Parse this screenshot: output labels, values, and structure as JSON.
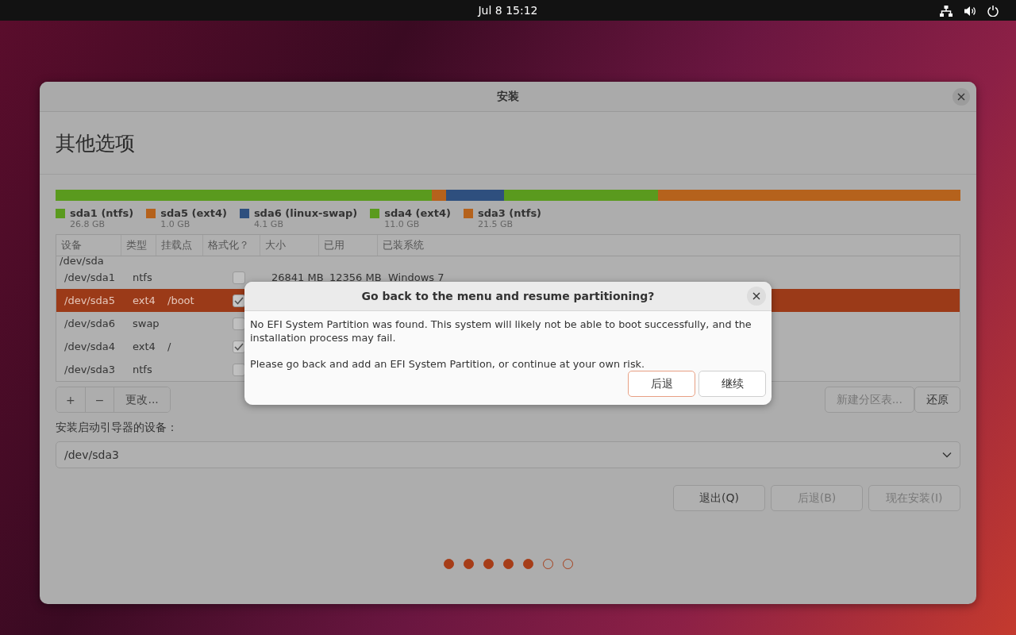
{
  "top_bar": {
    "clock": "Jul 8  15:12"
  },
  "window": {
    "title": "安装",
    "heading": "其他选项"
  },
  "partitions": [
    {
      "name": "sda1 (ntfs)",
      "size": "26.8 GB",
      "color": "#5a9a1e"
    },
    {
      "name": "sda5 (ext4)",
      "size": "1.0 GB",
      "color": "#b5621c"
    },
    {
      "name": "sda6 (linux-swap)",
      "size": "4.1 GB",
      "color": "#2e4f7e"
    },
    {
      "name": "sda4 (ext4)",
      "size": "11.0 GB",
      "color": "#5a9a1e"
    },
    {
      "name": "sda3 (ntfs)",
      "size": "21.5 GB",
      "color": "#b5621c"
    }
  ],
  "table": {
    "columns": [
      "设备",
      "类型",
      "挂载点",
      "格式化？",
      "大小",
      "已用",
      "已装系统"
    ],
    "rows": [
      {
        "kind": "disk",
        "device": "/dev/sda",
        "selected": false
      },
      {
        "kind": "partition",
        "device": "/dev/sda1",
        "type": "ntfs",
        "format": false,
        "size": "26841 MB",
        "used": "12356 MB",
        "system": "Windows 7",
        "selected": false
      },
      {
        "kind": "partition",
        "device": "/dev/sda5",
        "type": "ext4",
        "mount": "/boot",
        "format": true,
        "selected": true
      },
      {
        "kind": "partition",
        "device": "/dev/sda6",
        "type": "swap",
        "format": false,
        "selected": false
      },
      {
        "kind": "partition",
        "device": "/dev/sda4",
        "type": "ext4",
        "mount": "/",
        "format": true,
        "selected": false
      },
      {
        "kind": "partition",
        "device": "/dev/sda3",
        "type": "ntfs",
        "format": false,
        "selected": false
      }
    ]
  },
  "table_tools": [
    {
      "label": "+"
    },
    {
      "label": "−"
    },
    {
      "label": "更改..."
    }
  ],
  "table_actions": [
    {
      "label": "新建分区表...",
      "disabled": true
    },
    {
      "label": "还原",
      "disabled": false
    }
  ],
  "boot_loader": {
    "label": "安装启动引导器的设备：",
    "value": "/dev/sda3"
  },
  "buttons": [
    {
      "label": "退出(Q)",
      "disabled": false
    },
    {
      "label": "后退(B)",
      "disabled": true
    },
    {
      "label": "现在安装(I)",
      "disabled": true
    }
  ],
  "steps": [
    {
      "done": true
    },
    {
      "done": true
    },
    {
      "done": true
    },
    {
      "done": true
    },
    {
      "done": true
    },
    {
      "done": false
    },
    {
      "done": false
    }
  ],
  "dialog": {
    "title": "Go back to the menu and resume partitioning?",
    "message": "No EFI System Partition was found. This system will likely not be able to boot successfully, and the installation process may fail.",
    "note": "Please go back and add an EFI System Partition, or continue at your own risk.",
    "buttons": [
      {
        "label": "后退",
        "default": true
      },
      {
        "label": "继续",
        "default": false
      }
    ]
  }
}
